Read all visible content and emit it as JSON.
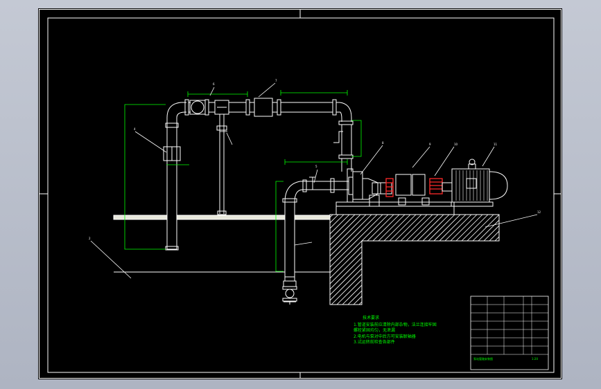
{
  "drawing": {
    "colors": {
      "background": "#000000",
      "frame": "#ffffff",
      "outline": "#ffffff",
      "dimension": "#00ff00",
      "coupling": "#ff2a2a",
      "viewport": "#b9bfcc"
    },
    "notes": {
      "title": "技术要求",
      "lines": [
        "1.管道安装前应清除内部杂物，法兰连接牢固",
        "螺栓紧固均匀，无泄漏",
        "2.电机与泵对中后方可安装联轴器",
        "3.试运转前检查各部件"
      ]
    },
    "title_block": {
      "drawing_title": "泵站管路安装图",
      "sheet": "1:20"
    }
  }
}
